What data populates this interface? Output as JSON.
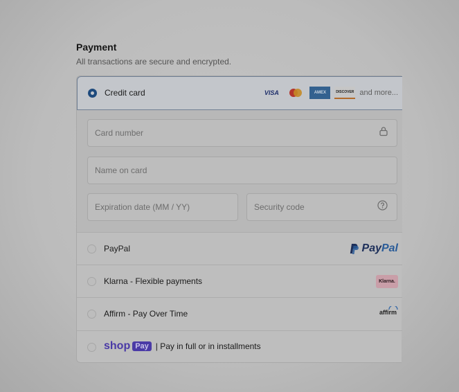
{
  "payment": {
    "title": "Payment",
    "subtitle": "All transactions are secure and encrypted."
  },
  "methods": {
    "credit_card": {
      "label": "Credit card",
      "selected": true,
      "logos": {
        "visa": "VISA",
        "amex": "AMEX",
        "discover": "DISCOVER",
        "more": "and more..."
      }
    },
    "card_form": {
      "card_number_placeholder": "Card number",
      "name_placeholder": "Name on card",
      "expiration_placeholder": "Expiration date (MM / YY)",
      "security_placeholder": "Security code"
    },
    "paypal": {
      "label": "PayPal",
      "logo_pay": "Pay",
      "logo_pal": "Pal"
    },
    "klarna": {
      "label": "Klarna - Flexible payments",
      "logo": "Klarna."
    },
    "affirm": {
      "label": "Affirm - Pay Over Time",
      "logo": "affirm"
    },
    "shop_pay": {
      "brand": "shop",
      "badge": "Pay",
      "label": "| Pay in full or in installments"
    }
  },
  "colors": {
    "accent": "#1e4a7d",
    "shop_pay": "#4a3aa6"
  },
  "icons": {
    "card_number": "lock-icon",
    "security_code": "help-circle-icon"
  }
}
